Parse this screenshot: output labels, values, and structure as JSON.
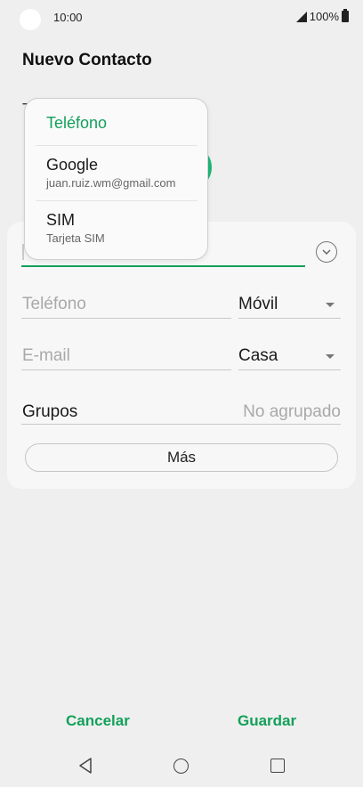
{
  "status_bar": {
    "time": "10:00",
    "battery": "100%"
  },
  "header": {
    "title": "Nuevo Contacto",
    "storage_label_partial": "T"
  },
  "storage_popup": {
    "items": [
      {
        "title": "Teléfono",
        "subtitle": "",
        "selected": true
      },
      {
        "title": "Google",
        "subtitle": "juan.ruiz.wm@gmail.com",
        "selected": false
      },
      {
        "title": "SIM",
        "subtitle": "Tarjeta SIM",
        "selected": false
      }
    ]
  },
  "form": {
    "phone_placeholder": "Teléfono",
    "phone_type": "Móvil",
    "email_placeholder": "E-mail",
    "email_type": "Casa",
    "groups_label": "Grupos",
    "groups_value": "No agrupado",
    "more_label": "Más"
  },
  "actions": {
    "cancel_label": "Cancelar",
    "save_label": "Guardar"
  },
  "colors": {
    "accent": "#13a05a",
    "avatar": "#1fb676",
    "background": "#efefef"
  },
  "icons": [
    "signal-icon",
    "battery-icon",
    "chevron-down-icon",
    "back-icon",
    "home-icon",
    "recents-icon"
  ]
}
